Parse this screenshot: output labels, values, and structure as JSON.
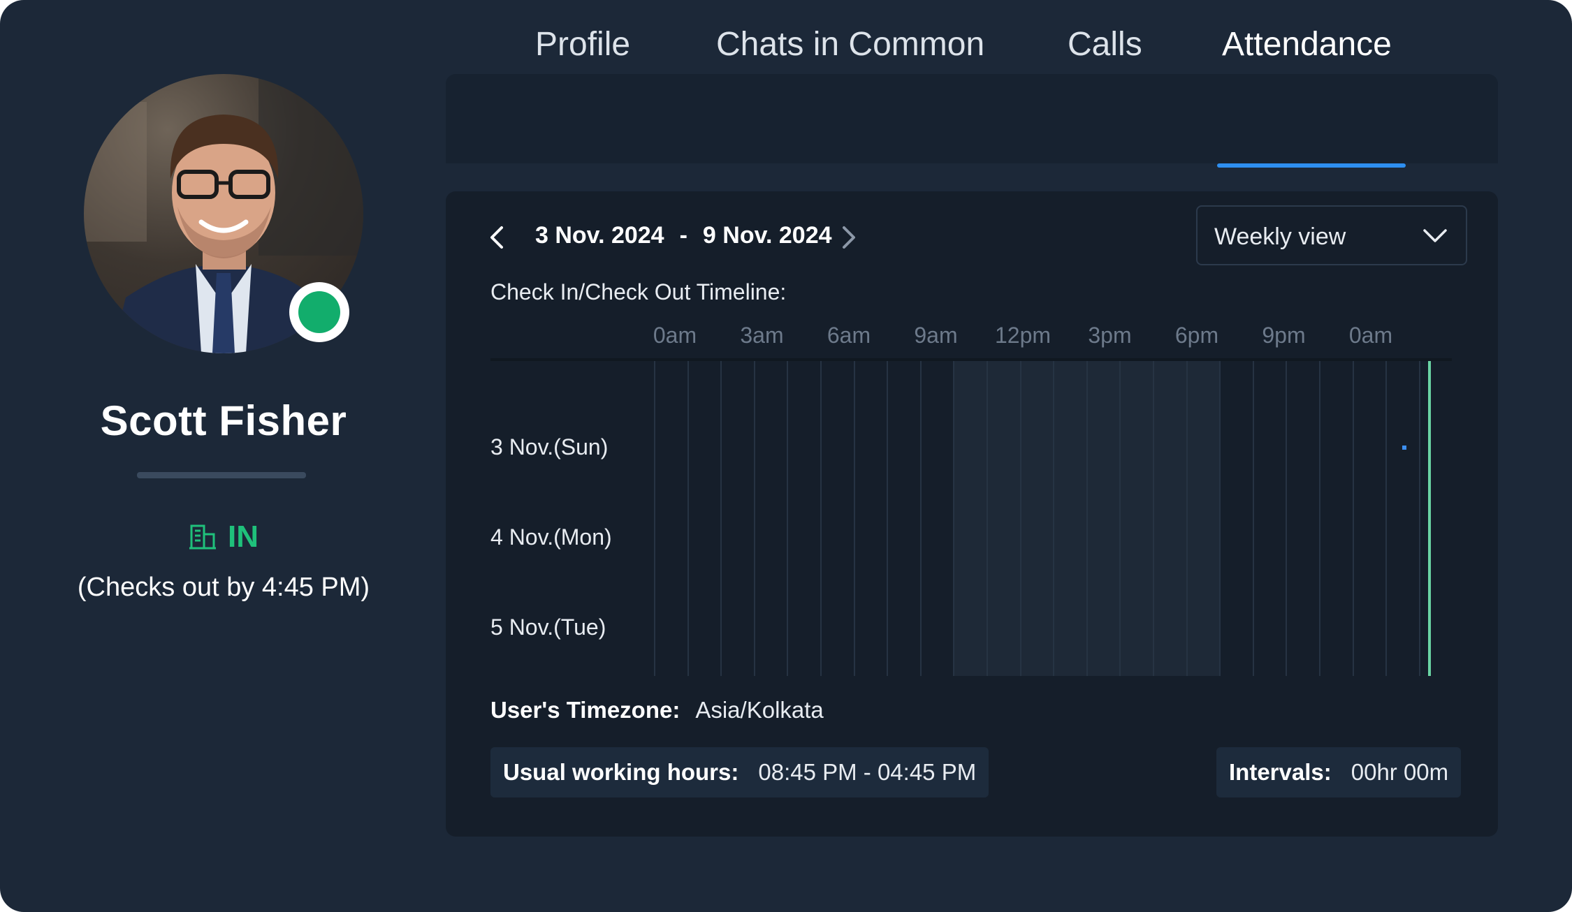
{
  "user": {
    "name": "Scott Fisher",
    "status": "IN",
    "checkout_note": "(Checks out by 4:45 PM)",
    "presence_color": "#12ad6c",
    "status_icon": "building-icon"
  },
  "tabs": [
    {
      "label": "Profile"
    },
    {
      "label": "Chats in Common"
    },
    {
      "label": "Calls"
    },
    {
      "label": "Attendance",
      "active": true
    }
  ],
  "attendance": {
    "date_start": "3 Nov. 2024",
    "date_separator": "-",
    "date_end": "9 Nov. 2024",
    "view_select": "Weekly view",
    "timeline_title": "Check In/Check Out Timeline:",
    "hours": [
      "0am",
      "3am",
      "6am",
      "9am",
      "12pm",
      "3pm",
      "6pm",
      "9pm",
      "0am"
    ],
    "days": [
      "3 Nov.(Sun)",
      "4 Nov.(Mon)",
      "5 Nov.(Tue)"
    ],
    "timezone_label": "User's Timezone:",
    "timezone_value": "Asia/Kolkata",
    "working_hours_label": "Usual working hours:",
    "working_hours_value": "08:45 PM - 04:45 PM",
    "intervals_label": "Intervals:",
    "intervals_value": "00hr 00m"
  },
  "colors": {
    "accent": "#2e8ff0",
    "status_green": "#1fc17b",
    "now_line": "#6ad4a4"
  }
}
